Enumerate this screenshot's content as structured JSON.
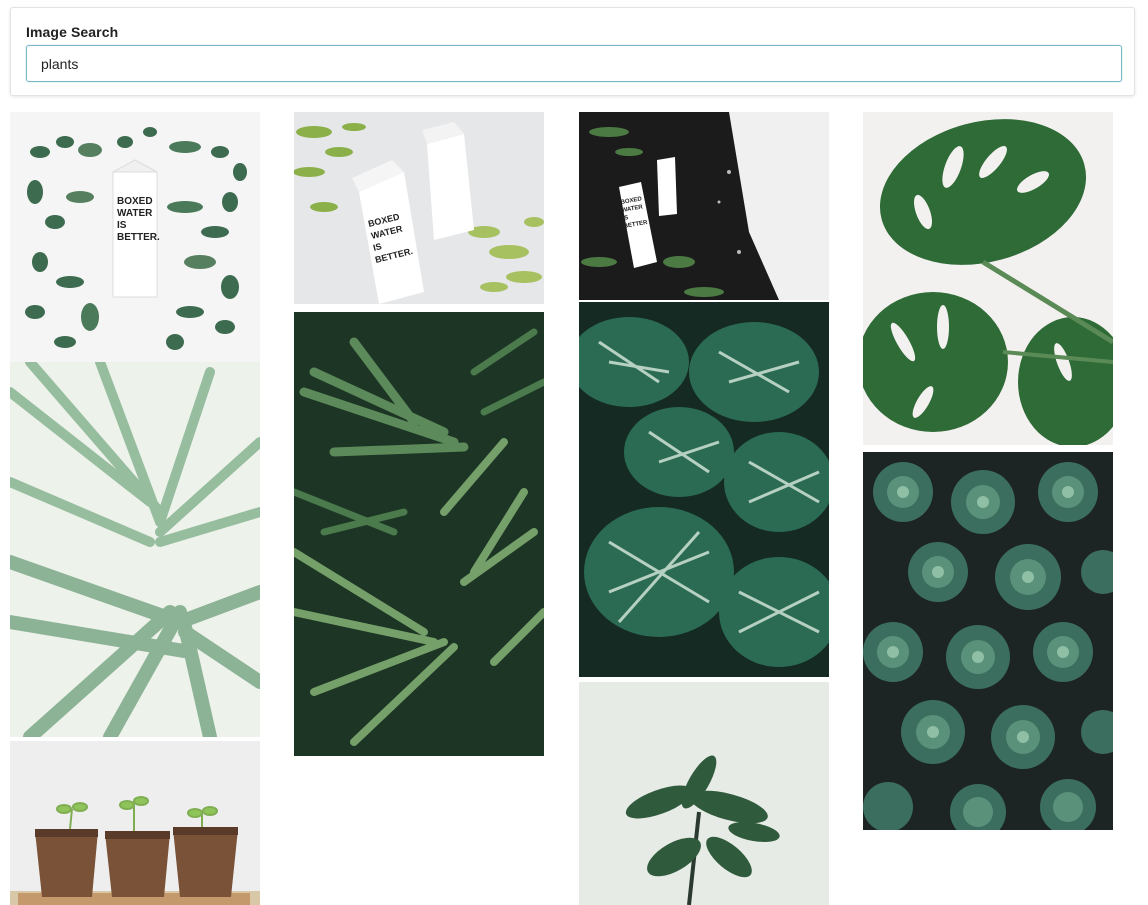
{
  "search": {
    "label": "Image Search",
    "value": "plants"
  },
  "results": {
    "column_count": 4,
    "images": [
      {
        "subject": "Boxed Water carton surrounded by leaves",
        "carton_text": "BOXED WATER IS BETTER."
      },
      {
        "subject": "Two Boxed Water cartons with ferns",
        "carton_text": "BOXED WATER IS BETTER."
      },
      {
        "subject": "Boxed Water cartons on soil with herbs",
        "carton_text": "BOXED WATER IS BETTER"
      },
      {
        "subject": "Monstera leaves on white"
      },
      {
        "subject": "Blurred palm fronds"
      },
      {
        "subject": "Dark green palm leaves"
      },
      {
        "subject": "Striped calathea leaves"
      },
      {
        "subject": "Echeveria succulents"
      },
      {
        "subject": "Seedlings in peat pots"
      },
      {
        "subject": "Fiddle-leaf plant on pale background"
      }
    ]
  },
  "colors": {
    "input_border": "#79b8c9",
    "leaf_dark": "#2c5e3a",
    "leaf_mid": "#3f7a4a",
    "leaf_light": "#8ab870",
    "soil": "#1a1a1a",
    "pot": "#7a5238"
  }
}
